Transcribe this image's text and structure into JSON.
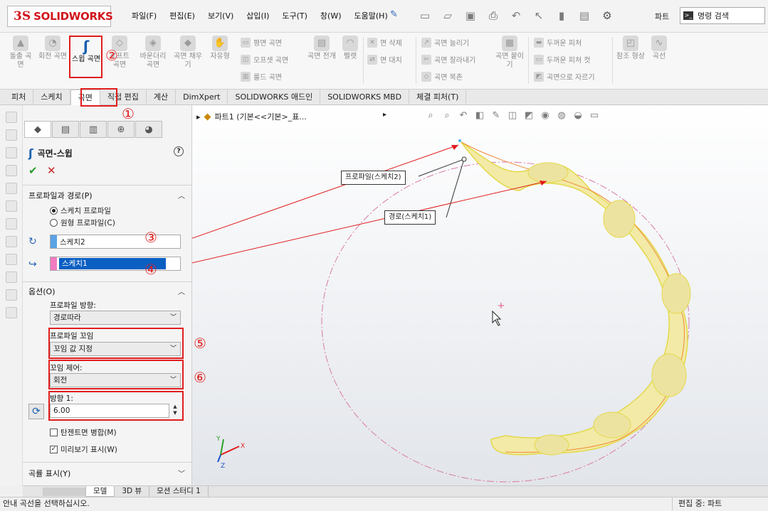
{
  "brand": {
    "ds": "3S",
    "name": "SOLIDWORKS"
  },
  "menus": [
    "파일(F)",
    "편집(E)",
    "보기(V)",
    "삽입(I)",
    "도구(T)",
    "창(W)",
    "도움말(H)"
  ],
  "quick_title": "파트",
  "search_placeholder": "명령 검색",
  "ribbon": {
    "b1": "돌출 곡면",
    "b2": "회전 곡면",
    "b3": "스윕 곡면",
    "b4": "로프트 곡면",
    "b5": "바운더리 곡면",
    "b6": "곡면 채우기",
    "b7": "자유형",
    "r1": "평면 곡면",
    "r2": "오프셋 곡면",
    "r3": "룰드 곡면",
    "b8": "곡면 전개",
    "b9": "펠렛",
    "r4": "면 삭제",
    "r5": "면 대치",
    "r6": "곡면 늘리기",
    "r7": "곡면 잘라내기",
    "r8": "곡면 복존",
    "b10": "곡면 붙이기",
    "r9": "두꺼운 피처",
    "r10": "두꺼운 피처 컷",
    "r11": "곡면으로 자르기",
    "b11": "참조 형상",
    "b12": "곡선"
  },
  "tabs": [
    "피처",
    "스케치",
    "곡면",
    "직접 편집",
    "계산",
    "DimXpert",
    "SOLIDWORKS 애드인",
    "SOLIDWORKS MBD",
    "체결 피처(T)"
  ],
  "pm": {
    "title": "곡면-스윕",
    "help": "?",
    "ok": "✔",
    "cancel": "✕",
    "sec1": "프로파일과 경로(P)",
    "opt_sketch": "스케치 프로파일",
    "opt_circle": "원형 프로파일(C)",
    "profile": "스케치2",
    "path": "스케치1",
    "sec2": "옵션(O)",
    "orient_label": "프로파일 방향:",
    "orient_value": "경로따라",
    "twist_label": "프로파일 꼬임",
    "twist_value": "꼬임 값 지정",
    "twistctl_label": "꼬임 제어:",
    "twistctl_value": "회전",
    "dir_label": "방향 1:",
    "dir_value": "6.00",
    "tangent": "탄젠트면 병합(M)",
    "preview": "미리보기 표시(W)",
    "sec3": "곡률 표시(Y)"
  },
  "tree": "파트1  (기본<<기본>_표...",
  "callouts": {
    "profile": "프로파일(스케치2)",
    "path": "경로(스케치1)"
  },
  "triad": {
    "x": "X",
    "y": "Y",
    "z": "Z"
  },
  "markers": [
    "①",
    "②",
    "③",
    "④",
    "⑤",
    "⑥"
  ],
  "colors": {
    "profile_swatch": "#5aa3e6",
    "path_swatch": "#f07cc0",
    "callout_red": "#e11d1d",
    "surface": "#f2eaa6"
  },
  "bottom_tabs": [
    "모델",
    "3D 뷰",
    "모션 스터디 1"
  ],
  "status": {
    "left": "안내 곡선을 선택하십시오.",
    "right": "편집 중: 파트"
  }
}
